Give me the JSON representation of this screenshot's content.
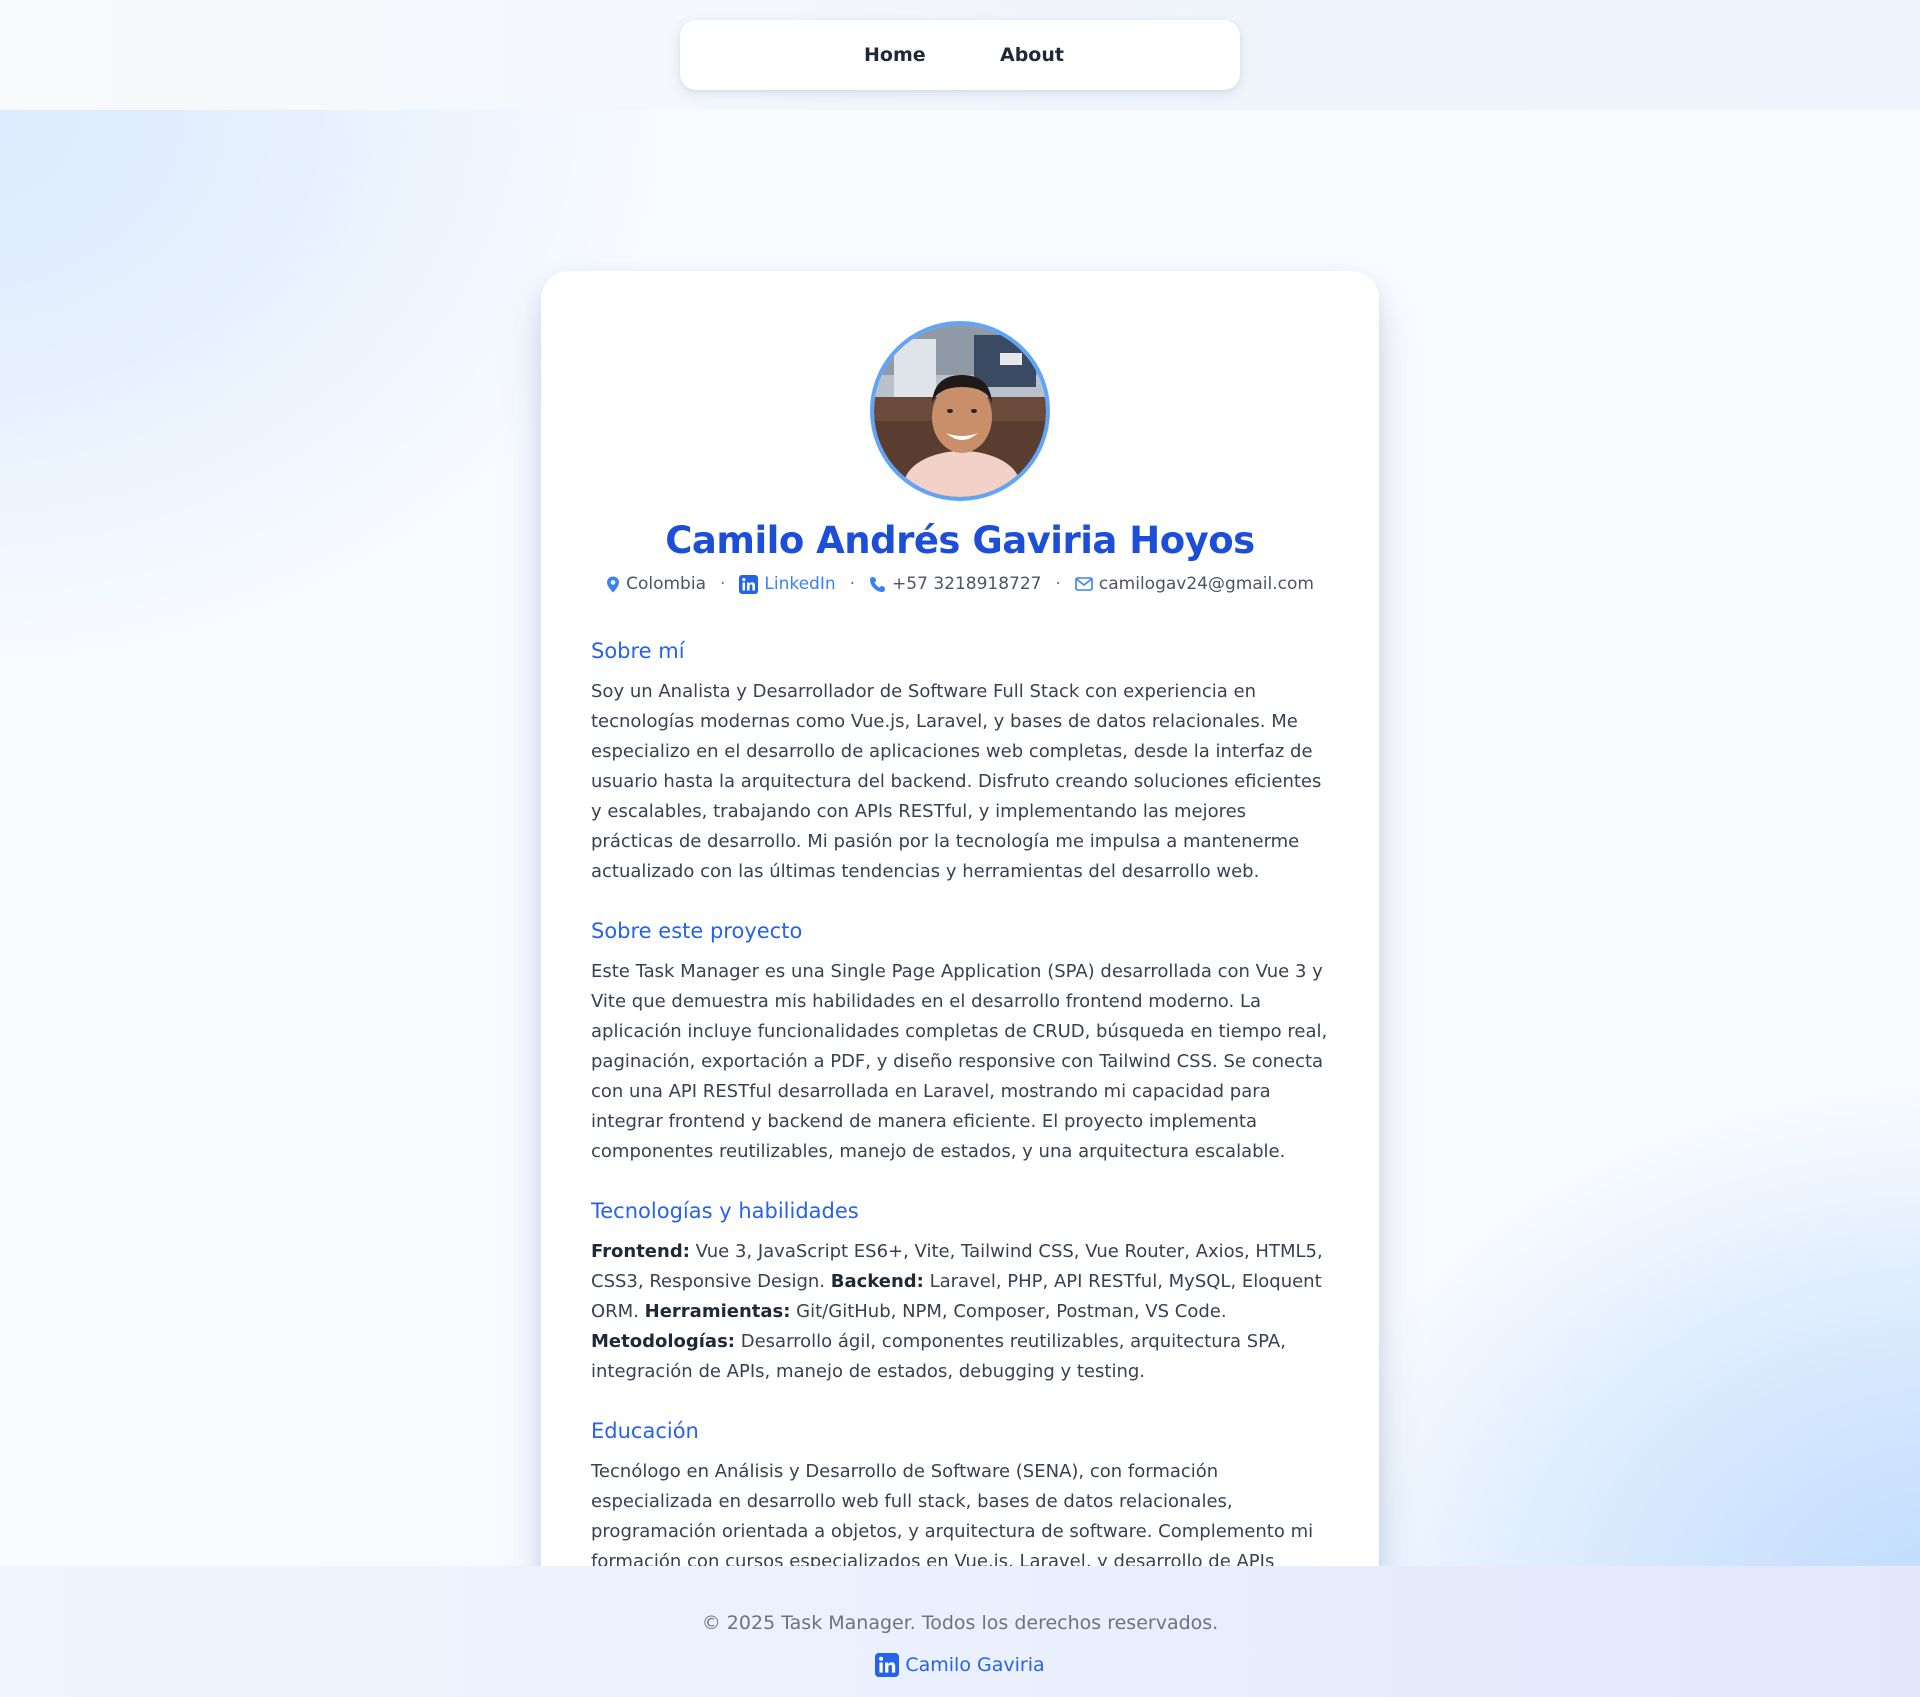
{
  "nav": {
    "home_label": "Home",
    "about_label": "About"
  },
  "profile": {
    "name": "Camilo Andrés Gaviria Hoyos",
    "location": "Colombia",
    "linkedin_label": "LinkedIn",
    "phone": "+57 3218918727",
    "email": "camilogav24@gmail.com",
    "separator": "·"
  },
  "sections": {
    "about_me": {
      "title": "Sobre mí",
      "body": "Soy un Analista y Desarrollador de Software Full Stack con experiencia en tecnologías modernas como Vue.js, Laravel, y bases de datos relacionales. Me especializo en el desarrollo de aplicaciones web completas, desde la interfaz de usuario hasta la arquitectura del backend. Disfruto creando soluciones eficientes y escalables, trabajando con APIs RESTful, y implementando las mejores prácticas de desarrollo. Mi pasión por la tecnología me impulsa a mantenerme actualizado con las últimas tendencias y herramientas del desarrollo web."
    },
    "project": {
      "title": "Sobre este proyecto",
      "body": "Este Task Manager es una Single Page Application (SPA) desarrollada con Vue 3 y Vite que demuestra mis habilidades en el desarrollo frontend moderno. La aplicación incluye funcionalidades completas de CRUD, búsqueda en tiempo real, paginación, exportación a PDF, y diseño responsive con Tailwind CSS. Se conecta con una API RESTful desarrollada en Laravel, mostrando mi capacidad para integrar frontend y backend de manera eficiente. El proyecto implementa componentes reutilizables, manejo de estados, y una arquitectura escalable."
    },
    "skills": {
      "title": "Tecnologías y habilidades",
      "frontend_label": "Frontend:",
      "frontend_text": " Vue 3, JavaScript ES6+, Vite, Tailwind CSS, Vue Router, Axios, HTML5, CSS3, Responsive Design. ",
      "backend_label": "Backend:",
      "backend_text": " Laravel, PHP, API RESTful, MySQL, Eloquent ORM. ",
      "tools_label": "Herramientas:",
      "tools_text": " Git/GitHub, NPM, Composer, Postman, VS Code. ",
      "methods_label": "Metodologías:",
      "methods_text": " Desarrollo ágil, componentes reutilizables, arquitectura SPA, integración de APIs, manejo de estados, debugging y testing."
    },
    "education": {
      "title": "Educación",
      "body": "Tecnólogo en Análisis y Desarrollo de Software (SENA), con formación especializada en desarrollo web full stack, bases de datos relacionales, programación orientada a objetos, y arquitectura de software. Complemento mi formación con cursos especializados en Vue.js, Laravel, y desarrollo de APIs modernas."
    }
  },
  "footer": {
    "copyright": "© 2025 Task Manager. Todos los derechos reservados.",
    "link_label": "Camilo Gaviria"
  },
  "icons": {
    "location": "map-pin-icon",
    "linkedin": "linkedin-icon",
    "phone": "phone-icon",
    "email": "mail-icon"
  },
  "colors": {
    "accent": "#2563eb",
    "name": "#1d4ed8",
    "avatar_border": "#60a5fa",
    "link": "#3b82f6"
  }
}
